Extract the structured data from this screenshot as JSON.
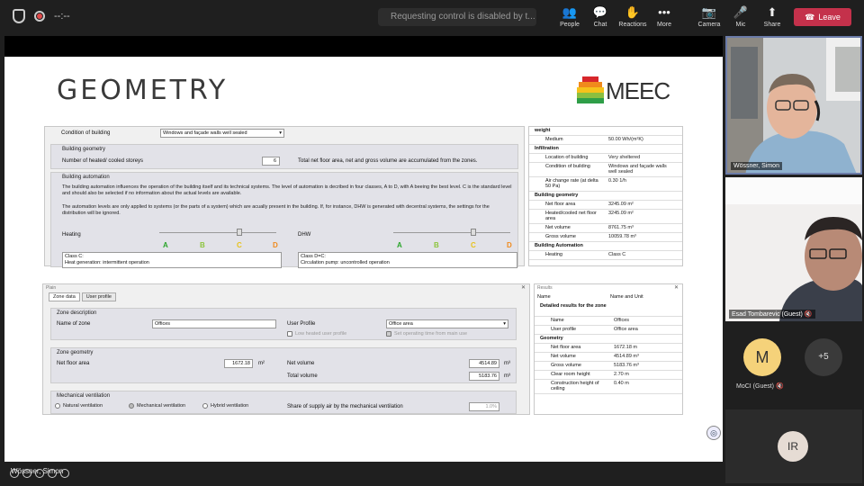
{
  "topbar": {
    "timer": "--:--",
    "request_status": "Requesting control is disabled by t...",
    "buttons": [
      {
        "label": "People",
        "icon": "people-icon",
        "glyph": "👥"
      },
      {
        "label": "Chat",
        "icon": "chat-icon",
        "glyph": "💬"
      },
      {
        "label": "Reactions",
        "icon": "reactions-icon",
        "glyph": "✋"
      },
      {
        "label": "More",
        "icon": "more-icon",
        "glyph": "•••"
      },
      {
        "label": "Camera",
        "icon": "camera-off-icon",
        "glyph": "📷"
      },
      {
        "label": "Mic",
        "icon": "mic-off-icon",
        "glyph": "🎤"
      },
      {
        "label": "Share",
        "icon": "share-icon",
        "glyph": "⬆"
      }
    ],
    "leave_label": "Leave"
  },
  "slide": {
    "title": "GEOMETRY",
    "logo_text": "MEEC",
    "logo_colors": [
      "#d7262b",
      "#f08a1c",
      "#f5c21b",
      "#8cbf3f",
      "#2f9e48"
    ],
    "upper": {
      "condition_label": "Condition of building",
      "condition_value": "Windows and façade walls well sealed",
      "geometry_header": "Building geometry",
      "storeys_label": "Number of heated/ cooled storeys",
      "storeys_value": "6",
      "storeys_note": "Total net floor area, net and gross volume  are accumulated from the zones.",
      "automation_header": "Building automation",
      "automation_text1": "The building automation influences the operation of the building itself and its technical systems. The level of automation is decribed in four classes, A to D, with A beeing the best level. C is the standard level and should also be selected if no information about the actual levels are available.",
      "automation_text2": "The automation levels are only applied to systems (or the parts of a system) which are acually present in the building. If, for instance, DHW is generated with decentral systems, the settings for the distribution will be ignored.",
      "heating_label": "Heating",
      "dhw_label": "DHW",
      "classes": [
        "A",
        "B",
        "C",
        "D"
      ],
      "class_colors": [
        "#2aa52a",
        "#8cc43c",
        "#e8c21b",
        "#f08a1c"
      ],
      "heating_box": "Class C:\nHeat generation: intermittent operation",
      "dhw_box": "Class D=C:\nCirculation pump: uncontrolled operation"
    },
    "upper_tree": [
      {
        "type": "group",
        "label": "weight"
      },
      {
        "label": "Medium",
        "value": "50.00 Wh/(m²K)"
      },
      {
        "type": "group",
        "label": "Infiltration"
      },
      {
        "label": "Location of building",
        "value": "Very sheltered"
      },
      {
        "label": "Condition of building",
        "value": "Windows and façade walls well sealed"
      },
      {
        "label": "Air change rate (at delta 50 Pa)",
        "value": "0.30 1/h"
      },
      {
        "type": "group",
        "label": "Building geometry"
      },
      {
        "label": "Net floor area",
        "value": "3245.09 m²"
      },
      {
        "label": "Heated/cooled net floor area",
        "value": "3245.09 m²"
      },
      {
        "label": "Net volume",
        "value": "8761.75 m³"
      },
      {
        "label": "Gross volume",
        "value": "10059.78 m³"
      },
      {
        "type": "group",
        "label": "Building Automation"
      },
      {
        "label": "Heating",
        "value": "Class C"
      }
    ],
    "lower": {
      "panel_title": "Plain",
      "tabs": [
        "Zone data",
        "User profile"
      ],
      "zone_desc_header": "Zone description",
      "zone_name_label": "Name of zone",
      "zone_name_value": "Offices",
      "user_profile_label": "User Profile",
      "user_profile_value": "Office area",
      "low_heated_label": "Low heated user profile",
      "set_operating_label": "Set operating time from main use",
      "zone_geom_header": "Zone geometry",
      "net_floor_label": "Net floor area",
      "net_floor_value": "1672.18",
      "net_floor_unit": "m²",
      "net_volume_label": "Net volume",
      "net_volume_value": "4514.89",
      "net_volume_unit": "m³",
      "total_volume_label": "Total volume",
      "total_volume_value": "5183.76",
      "total_volume_unit": "m³",
      "mech_vent_header": "Mechanical ventilation",
      "radio_natural": "Natural ventilation",
      "radio_mechanical": "Mechanical ventilation",
      "radio_hybrid": "Hybrid ventilation",
      "share_label": "Share of supply air by the mechanical ventilation",
      "share_value": "1.0%"
    },
    "results": {
      "title": "Results",
      "col1": "Name",
      "col2": "Name and Unit",
      "rows": [
        {
          "type": "group",
          "label": "Detailed results for the zone"
        },
        {
          "label": "Name",
          "value": "Offices"
        },
        {
          "label": "User profile",
          "value": "Office area"
        },
        {
          "type": "group",
          "label": "Geometry"
        },
        {
          "label": "Net floor area",
          "value": "1672.18 m"
        },
        {
          "label": "Net volume",
          "value": "4514.89 m³"
        },
        {
          "label": "Gross volume",
          "value": "5183.76 m³"
        },
        {
          "label": "Clear room height",
          "value": "2.70 m"
        },
        {
          "label": "Construction height of ceiling",
          "value": "0.40 m"
        }
      ]
    }
  },
  "presenter_name": "Wössner, Simon",
  "participants": [
    {
      "name": "Wössner, Simon",
      "type": "video"
    },
    {
      "name": "Esad Tombarevic (Guest)",
      "type": "video"
    },
    {
      "name": "MoCI (Guest)",
      "initial": "M",
      "type": "avatar",
      "color": "#f5d27a"
    },
    {
      "overflow": "+5"
    },
    {
      "initial": "IR",
      "type": "avatar",
      "color": "#e6dcd4"
    }
  ]
}
